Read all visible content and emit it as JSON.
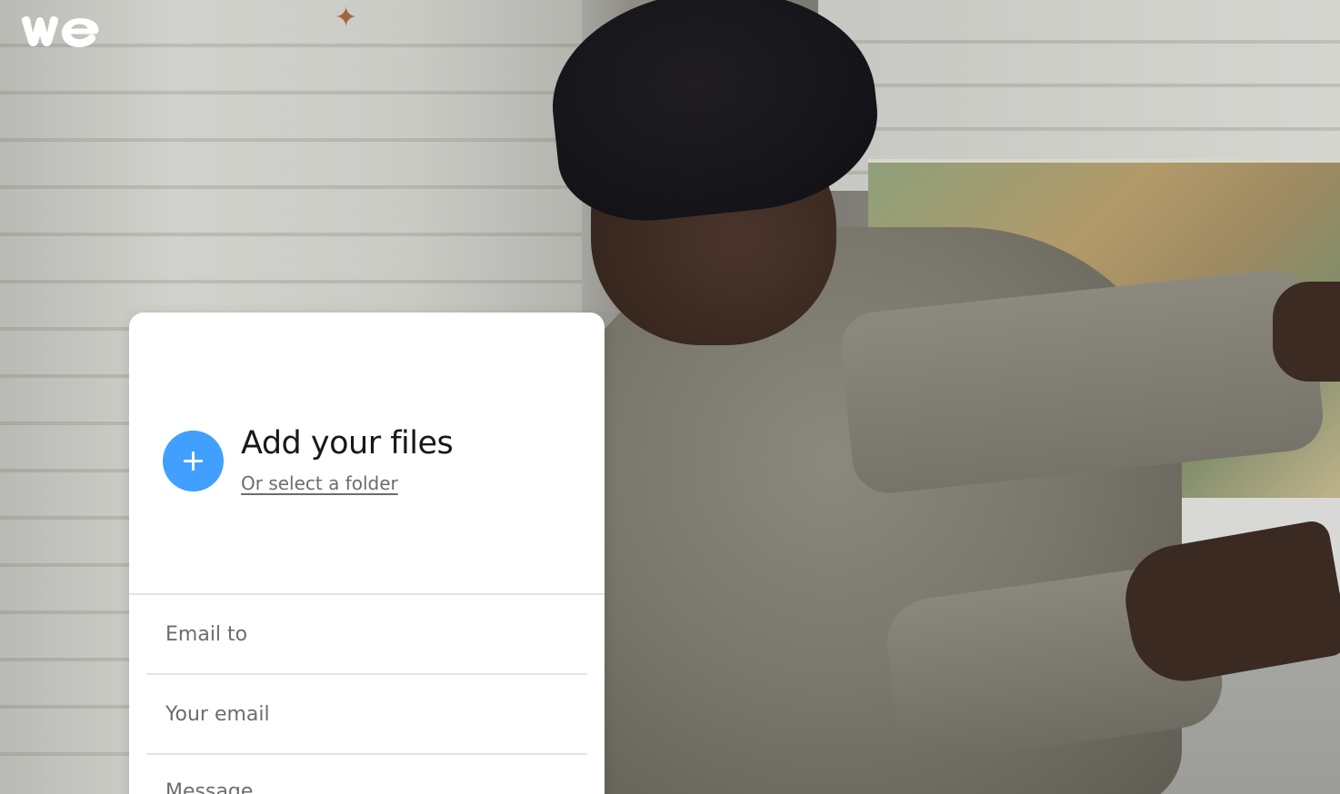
{
  "logo": {
    "alt_text": "we"
  },
  "upload": {
    "add_title": "Add your files",
    "add_icon": "plus-icon",
    "select_folder_link": "Or select a folder"
  },
  "form": {
    "email_to_placeholder": "Email to",
    "your_email_placeholder": "Your email",
    "message_placeholder": "Message"
  },
  "colors": {
    "accent": "#409fff",
    "panel_background": "#ffffff",
    "text_primary": "#17181a",
    "text_secondary": "#6a6d70",
    "divider": "#e3e4e6"
  }
}
